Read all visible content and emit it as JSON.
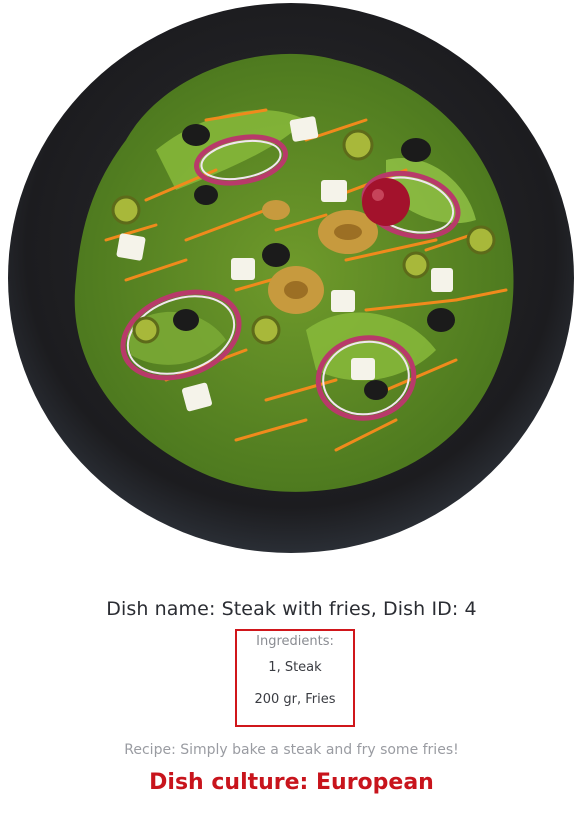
{
  "dish": {
    "image_alt": "salad",
    "name_line": "Dish name: Steak with fries, Dish ID: 4",
    "ingredients_title": "Ingredients:",
    "ingredients": [
      "1, Steak",
      "200 gr, Fries"
    ],
    "recipe_line": "Recipe: Simply bake a steak and fry some fries!",
    "culture_line": "Dish culture: European"
  },
  "colors": {
    "highlight_border": "#d0161b",
    "culture_text": "#c8141c",
    "plate": "#1f1f22"
  }
}
